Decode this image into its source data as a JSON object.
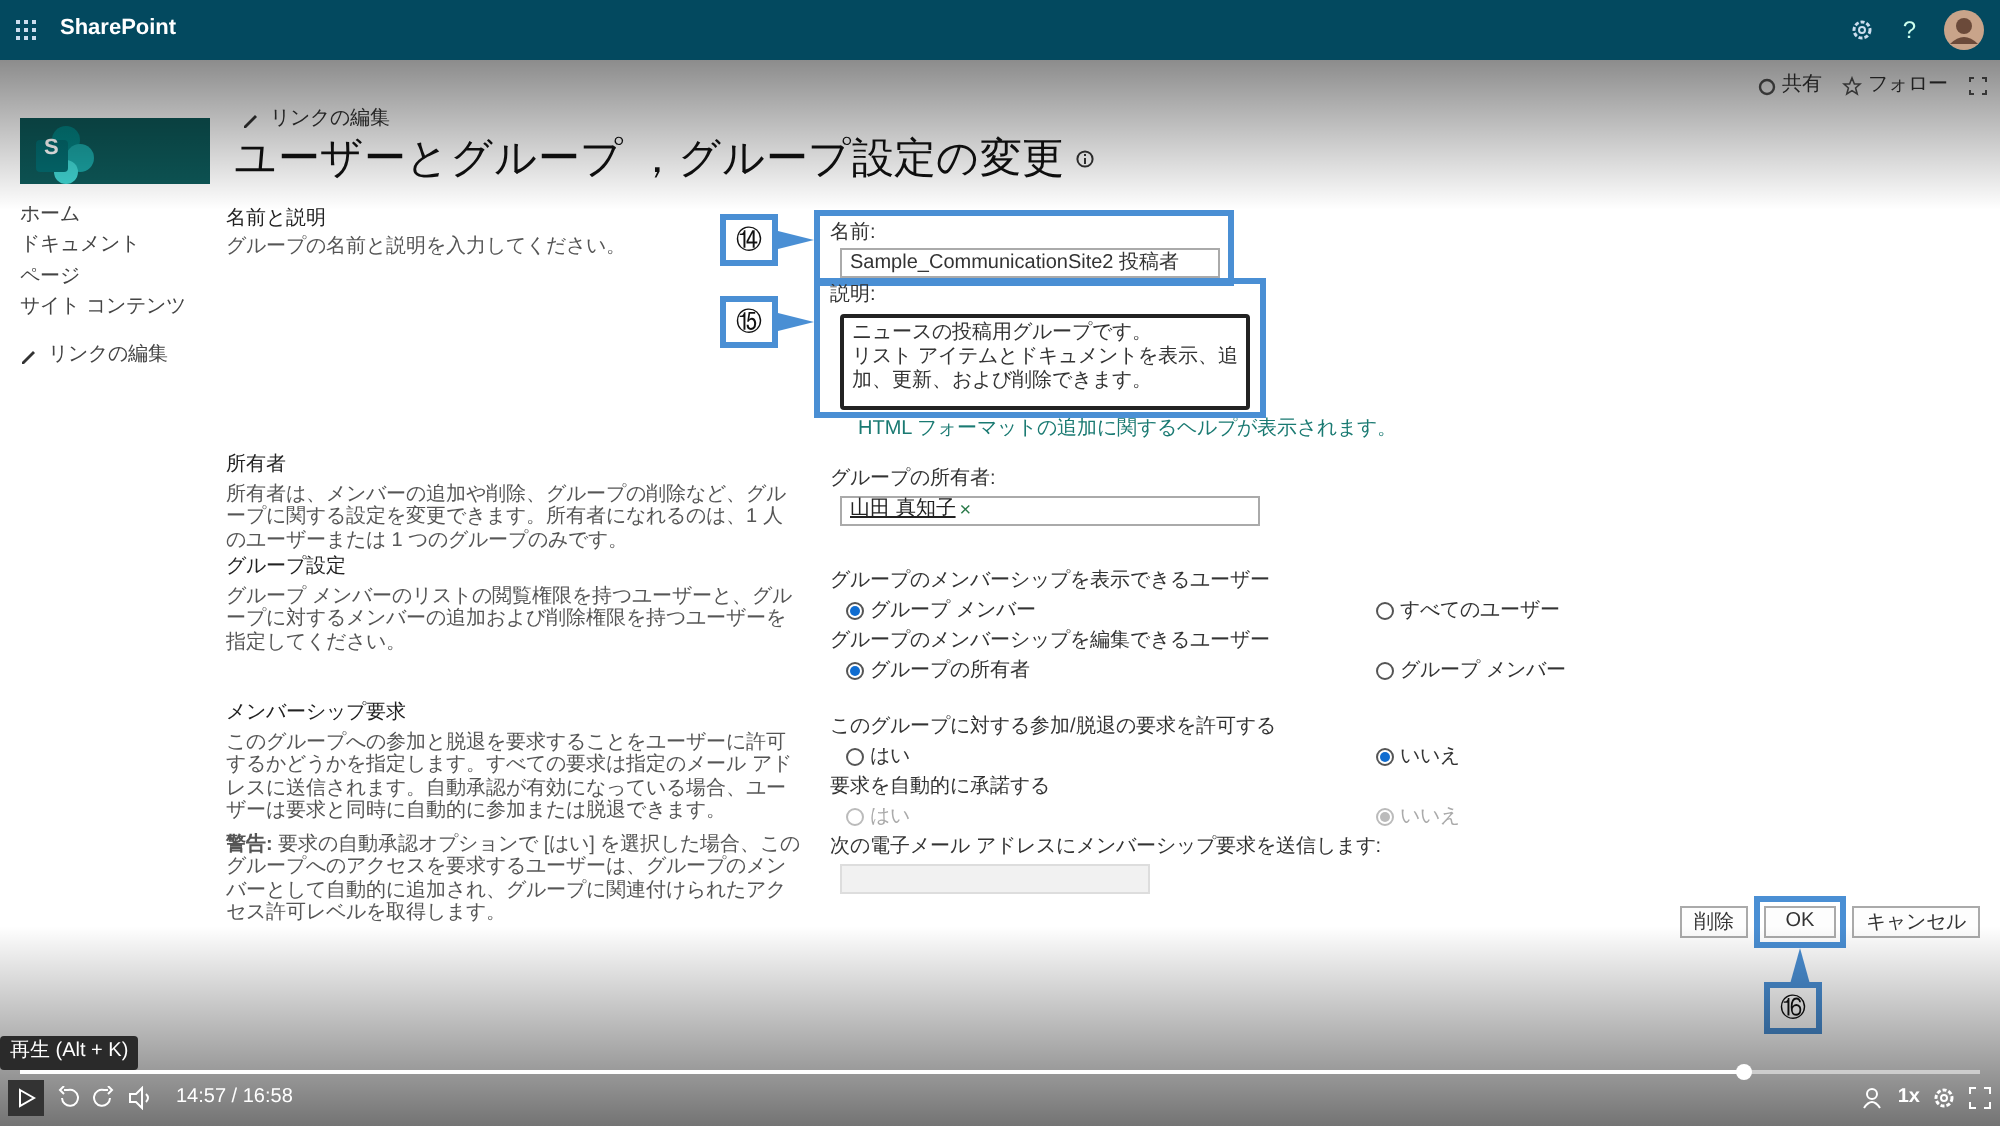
{
  "suite_bar": {
    "app_name": "SharePoint",
    "help": "?"
  },
  "command_bar": {
    "share": "共有",
    "follow": "フォロー"
  },
  "header": {
    "logo_letter": "S",
    "edit_links": "リンクの編集",
    "title": "ユーザーとグループ ，グループ設定の変更"
  },
  "nav": {
    "items": [
      {
        "label": "ホーム"
      },
      {
        "label": "ドキュメント"
      },
      {
        "label": "ページ"
      },
      {
        "label": "サイト コンテンツ"
      }
    ],
    "edit_links": "リンクの編集"
  },
  "sections": [
    {
      "title": "名前と説明",
      "description": "グループの名前と説明を入力してください。",
      "fields": [
        {
          "kind": "text",
          "label": "名前:",
          "value": "Sample_CommunicationSite2 投稿者",
          "callout": "⑭"
        },
        {
          "kind": "textarea",
          "label": "説明:",
          "paragraphs": [
            "ニュースの投稿用グループです。",
            "リスト アイテムとドキュメントを表示、追加、更新、および削除できます。"
          ],
          "callout": "⑮",
          "hint": "HTML フォーマットの追加に関するヘルプが表示されます。"
        }
      ]
    },
    {
      "title": "所有者",
      "description": "所有者は、メンバーの追加や削除、グループの削除など、グループに関する設定を変更できます。所有者になれるのは、1 人のユーザーまたは 1 つのグループのみです。",
      "fields": [
        {
          "kind": "people",
          "label": "グループの所有者:",
          "value": "山田 真知子",
          "remove": "×"
        }
      ]
    },
    {
      "title": "グループ設定",
      "description": "グループ メンバーのリストの閲覧権限を持つユーザーと、グループに対するメンバーの追加および削除権限を持つユーザーを指定してください。",
      "fields": [
        {
          "kind": "radio",
          "label": "グループのメンバーシップを表示できるユーザー",
          "options": [
            {
              "label": "グループ メンバー",
              "selected": true,
              "disabled": false
            },
            {
              "label": "すべてのユーザー",
              "selected": false,
              "disabled": false
            }
          ]
        },
        {
          "kind": "radio",
          "label": "グループのメンバーシップを編集できるユーザー",
          "options": [
            {
              "label": "グループの所有者",
              "selected": true,
              "disabled": false
            },
            {
              "label": "グループ メンバー",
              "selected": false,
              "disabled": false
            }
          ]
        }
      ]
    },
    {
      "title": "メンバーシップ要求",
      "description": "このグループへの参加と脱退を要求することをユーザーに許可するかどうかを指定します。すべての要求は指定のメール アドレスに送信されます。自動承認が有効になっている場合、ユーザーは要求と同時に自動的に参加または脱退できます。",
      "warning": "**警告:** 要求の自動承認オプションで [はい] を選択した場合、このグループへのアクセスを要求するユーザーは、グループのメンバーとして自動的に追加され、グループに関連付けられたアクセス許可レベルを取得します。",
      "fields": [
        {
          "kind": "radio",
          "label": "このグループに対する参加/脱退の要求を許可する",
          "options": [
            {
              "label": "はい",
              "selected": false,
              "disabled": false
            },
            {
              "label": "いいえ",
              "selected": true,
              "disabled": false
            }
          ]
        },
        {
          "kind": "radio",
          "label": "要求を自動的に承諾する",
          "options": [
            {
              "label": "はい",
              "selected": false,
              "disabled": true
            },
            {
              "label": "いいえ",
              "selected": true,
              "disabled": true
            }
          ]
        },
        {
          "kind": "text",
          "label": "次の電子メール アドレスにメンバーシップ要求を送信します:",
          "disabled": true
        }
      ]
    }
  ],
  "buttons": [
    {
      "label": "削除"
    },
    {
      "label": "OK",
      "callout": "⑯"
    },
    {
      "label": "キャンセル"
    }
  ],
  "player": {
    "tooltip": "再生 (Alt + K)",
    "level": 0.88,
    "time": "14:57 / 16:58",
    "speed": "1x"
  }
}
